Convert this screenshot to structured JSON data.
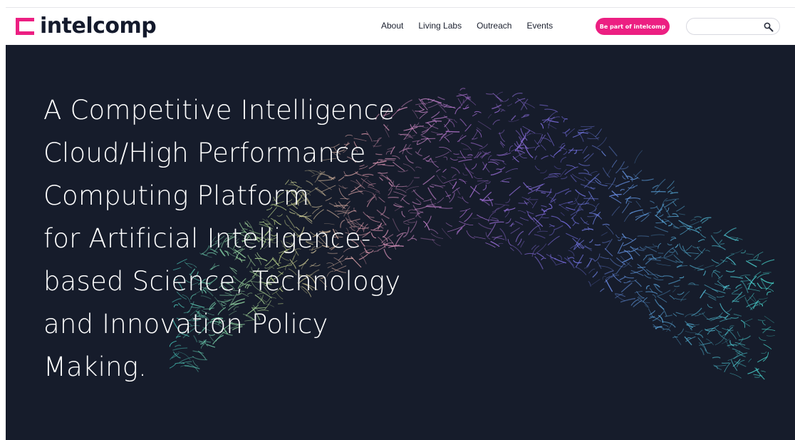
{
  "brand": {
    "name": "intelcomp",
    "accent": "#ec1f82",
    "dark": "#141a2c"
  },
  "nav": {
    "items": [
      "About",
      "Living Labs",
      "Outreach",
      "Events"
    ]
  },
  "cta": {
    "label": "Be part of intelcomp"
  },
  "search": {
    "value": "",
    "placeholder": "",
    "icon": "search-icon"
  },
  "hero": {
    "background": "#161c2b",
    "title_lines": [
      "A Competitive Intelligence",
      "Cloud/High Performance",
      "Computing Platform",
      "for Artificial Intelligence-",
      "based Science, Technology",
      "and Innovation Policy",
      "Making."
    ]
  }
}
